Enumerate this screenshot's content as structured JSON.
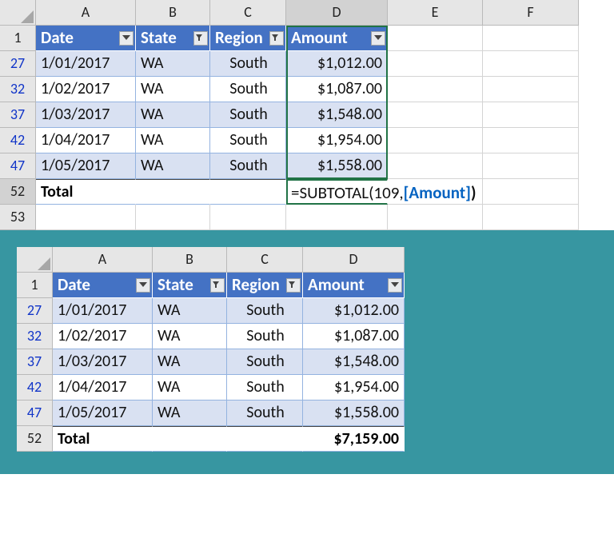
{
  "columns": [
    "A",
    "B",
    "C",
    "D",
    "E",
    "F"
  ],
  "headerRow": "1",
  "headers": {
    "A": "Date",
    "B": "State",
    "C": "Region",
    "D": "Amount"
  },
  "rows": [
    {
      "n": "27",
      "A": "1/01/2017",
      "B": "WA",
      "C": "South",
      "D": "$1,012.00"
    },
    {
      "n": "32",
      "A": "1/02/2017",
      "B": "WA",
      "C": "South",
      "D": "$1,087.00"
    },
    {
      "n": "37",
      "A": "1/03/2017",
      "B": "WA",
      "C": "South",
      "D": "$1,548.00"
    },
    {
      "n": "42",
      "A": "1/04/2017",
      "B": "WA",
      "C": "South",
      "D": "$1,954.00"
    },
    {
      "n": "47",
      "A": "1/05/2017",
      "B": "WA",
      "C": "South",
      "D": "$1,558.00"
    }
  ],
  "totalLabel": "Total",
  "totalRowNum": "52",
  "blankRowNum": "53",
  "formula": {
    "prefix": "=SUBTOTAL(109,",
    "ref": "[Amount]",
    "suffix": ")"
  },
  "totalValue": "$7,159.00",
  "chart_data": {
    "type": "table",
    "columns": [
      "Date",
      "State",
      "Region",
      "Amount"
    ],
    "rows": [
      [
        "1/01/2017",
        "WA",
        "South",
        1012.0
      ],
      [
        "1/02/2017",
        "WA",
        "South",
        1087.0
      ],
      [
        "1/03/2017",
        "WA",
        "South",
        1548.0
      ],
      [
        "1/04/2017",
        "WA",
        "South",
        1954.0
      ],
      [
        "1/05/2017",
        "WA",
        "South",
        1558.0
      ]
    ],
    "total": 7159.0,
    "formula": "=SUBTOTAL(109,[Amount])"
  }
}
